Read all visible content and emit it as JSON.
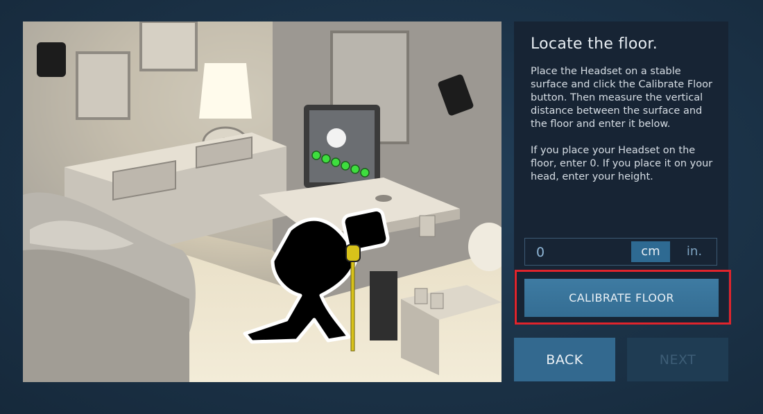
{
  "panel": {
    "title": "Locate the floor.",
    "paragraph1": "Place the Headset on a stable surface and click the Calibrate Floor button. Then measure the vertical distance between the surface and the floor and enter it below.",
    "paragraph2": "If you place your Headset on the floor, enter 0. If you place it on your head, enter your height."
  },
  "measurement": {
    "value": "0",
    "units": [
      "cm",
      "in."
    ],
    "selected_unit": "cm"
  },
  "calibrate_label": "CALIBRATE FLOOR",
  "nav": {
    "back_label": "BACK",
    "next_label": "NEXT",
    "next_enabled": false
  },
  "colors": {
    "background": "#1c3448",
    "panel": "#172434",
    "button": "#3e7ba2",
    "highlight": "#e0242c",
    "tape_measure": "#d8c21a"
  }
}
